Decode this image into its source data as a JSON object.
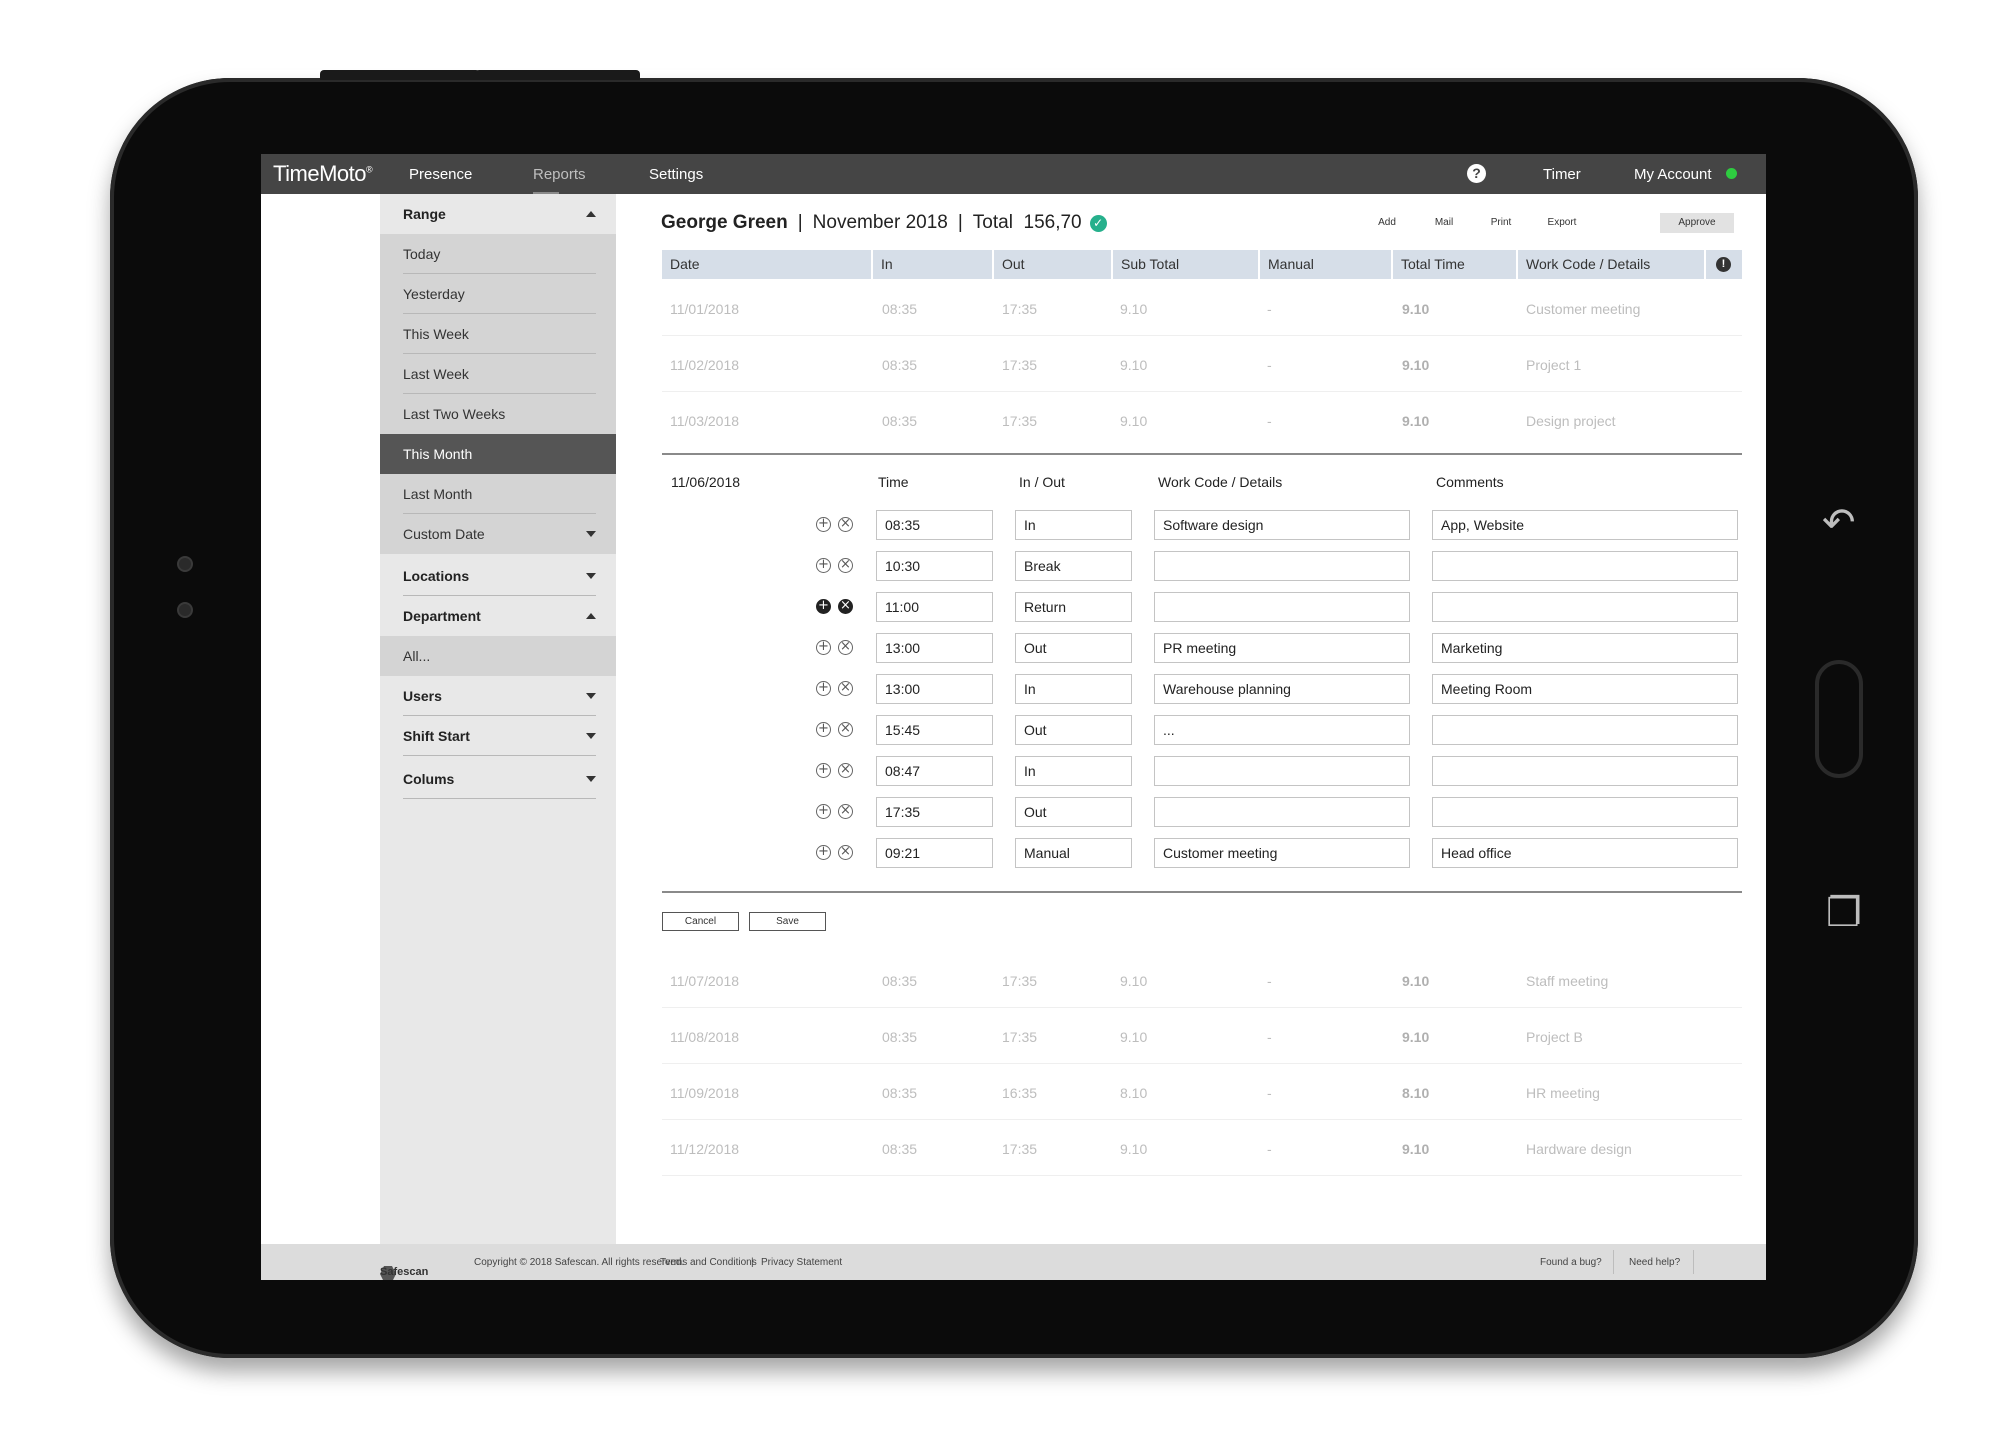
{
  "app": {
    "logo": "TimeMoto",
    "nav": {
      "presence": "Presence",
      "reports": "Reports",
      "settings": "Settings",
      "timer": "Timer",
      "my_account": "My Account"
    },
    "help_glyph": "?",
    "status_color": "#2ecc40"
  },
  "sidebar": {
    "range": "Range",
    "range_items": [
      "Today",
      "Yesterday",
      "This Week",
      "Last Week",
      "Last Two Weeks",
      "This Month",
      "Last Month",
      "Custom Date"
    ],
    "selected_range": "This Month",
    "locations": "Locations",
    "department": "Department",
    "department_value": "All...",
    "users": "Users",
    "shift_start": "Shift Start",
    "columns": "Colums"
  },
  "header": {
    "employee": "George Green",
    "month": "November 2018",
    "total_label": "Total",
    "total_value": "156,70",
    "actions": {
      "add": "Add",
      "mail": "Mail",
      "print": "Print",
      "export": "Export",
      "approve": "Approve"
    }
  },
  "table": {
    "columns": [
      "Date",
      "In",
      "Out",
      "Sub Total",
      "Manual",
      "Total Time",
      "Work Code / Details"
    ],
    "rows_before": [
      {
        "date": "11/01/2018",
        "in": "08:35",
        "out": "17:35",
        "sub": "9.10",
        "manual": "-",
        "total": "9.10",
        "code": "Customer meeting"
      },
      {
        "date": "11/02/2018",
        "in": "08:35",
        "out": "17:35",
        "sub": "9.10",
        "manual": "-",
        "total": "9.10",
        "code": "Project 1"
      },
      {
        "date": "11/03/2018",
        "in": "08:35",
        "out": "17:35",
        "sub": "9.10",
        "manual": "-",
        "total": "9.10",
        "code": "Design project"
      }
    ],
    "rows_after": [
      {
        "date": "11/07/2018",
        "in": "08:35",
        "out": "17:35",
        "sub": "9.10",
        "manual": "-",
        "total": "9.10",
        "code": "Staff meeting"
      },
      {
        "date": "11/08/2018",
        "in": "08:35",
        "out": "17:35",
        "sub": "9.10",
        "manual": "-",
        "total": "9.10",
        "code": "Project B"
      },
      {
        "date": "11/09/2018",
        "in": "08:35",
        "out": "16:35",
        "sub": "8.10",
        "manual": "-",
        "total": "8.10",
        "code": "HR meeting"
      },
      {
        "date": "11/12/2018",
        "in": "08:35",
        "out": "17:35",
        "sub": "9.10",
        "manual": "-",
        "total": "9.10",
        "code": "Hardware design"
      }
    ]
  },
  "edit": {
    "date": "11/06/2018",
    "headers": {
      "time": "Time",
      "inout": "In / Out",
      "code": "Work Code / Details",
      "comments": "Comments"
    },
    "entries": [
      {
        "time": "08:35",
        "type": "In",
        "code": "Software design",
        "comment": "App, Website"
      },
      {
        "time": "10:30",
        "type": "Break",
        "code": "",
        "comment": ""
      },
      {
        "time": "11:00",
        "type": "Return",
        "code": "",
        "comment": ""
      },
      {
        "time": "13:00",
        "type": "Out",
        "code": "PR meeting",
        "comment": "Marketing"
      },
      {
        "time": "13:00",
        "type": "In",
        "code": "Warehouse planning",
        "comment": "Meeting Room"
      },
      {
        "time": "15:45",
        "type": "Out",
        "code": "...",
        "comment": ""
      },
      {
        "time": "08:47",
        "type": "In",
        "code": "",
        "comment": ""
      },
      {
        "time": "17:35",
        "type": "Out",
        "code": "",
        "comment": ""
      },
      {
        "time": "09:21",
        "type": "Manual",
        "code": "Customer meeting",
        "comment": "Head office"
      }
    ],
    "cancel": "Cancel",
    "save": "Save"
  },
  "footer": {
    "brand": "Safescan",
    "copyright": "Copyright © 2018 Safescan. All rights reserved.",
    "terms": "Terms and Conditions",
    "separator": "|",
    "privacy": "Privacy Statement",
    "bug": "Found a bug?",
    "help": "Need help?"
  }
}
